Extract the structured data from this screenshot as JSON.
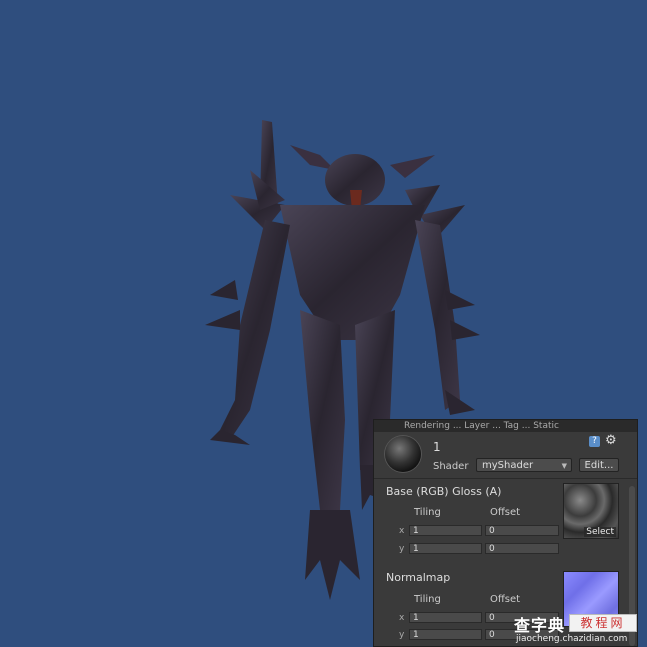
{
  "inspector": {
    "header_strip": "Rendering ... Layer ... Tag ... Static",
    "material_name": "1",
    "shader_label": "Shader",
    "shader_value": "myShader",
    "edit_label": "Edit...",
    "help_icon_glyph": "?",
    "gear_icon_glyph": "⚙",
    "properties": [
      {
        "title": "Base (RGB) Gloss (A)",
        "tiling_label": "Tiling",
        "offset_label": "Offset",
        "x_label": "x",
        "y_label": "y",
        "tiling_x": "1",
        "tiling_y": "1",
        "offset_x": "0",
        "offset_y": "0",
        "select_label": "Select"
      },
      {
        "title": "Normalmap",
        "tiling_label": "Tiling",
        "offset_label": "Offset",
        "x_label": "x",
        "y_label": "y",
        "tiling_x": "1",
        "tiling_y": "1",
        "offset_x": "0",
        "offset_y": "0"
      }
    ]
  },
  "watermark": {
    "main": "查字典",
    "box": "教程网",
    "sub": "jiaocheng.chazidian.com"
  },
  "colors": {
    "viewport_bg": "#2f4e7e",
    "panel_bg": "#3a3a3a",
    "normalmap": "#8080ff"
  }
}
